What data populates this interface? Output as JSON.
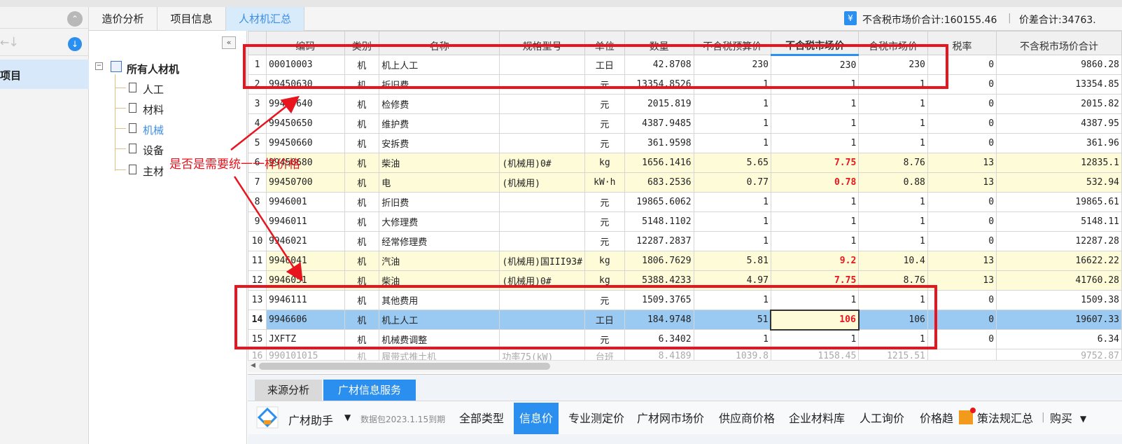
{
  "top_tabs": [
    {
      "label": "造价分析",
      "active": false
    },
    {
      "label": "项目信息",
      "active": false
    },
    {
      "label": "人材机汇总",
      "active": true
    }
  ],
  "summary": {
    "market_total": "不含税市场价合计:160155.46",
    "diff_total": "价差合计:34763."
  },
  "left_panel": {
    "project_label": "项目"
  },
  "tree": {
    "root": "所有人材机",
    "children": [
      "人工",
      "材料",
      "机械",
      "设备",
      "主材"
    ],
    "active_child": "机械"
  },
  "grid": {
    "columns": [
      "编码",
      "类别",
      "名称",
      "规格型号",
      "单位",
      "数量",
      "不含税预算价",
      "不含税市场价",
      "含税市场价",
      "税率",
      "不含税市场价合计"
    ],
    "rows": [
      {
        "n": "1",
        "code": "00010003",
        "type": "机",
        "name": "机上人工",
        "spec": "",
        "unit": "工日",
        "qty": "42.8708",
        "budget": "230",
        "market": "230",
        "tax_market": "230",
        "rate": "0",
        "total": "9860.28",
        "style": ""
      },
      {
        "n": "2",
        "code": "99450630",
        "type": "机",
        "name": "折旧费",
        "spec": "",
        "unit": "元",
        "qty": "13354.8526",
        "budget": "1",
        "market": "1",
        "tax_market": "1",
        "rate": "0",
        "total": "13354.85",
        "style": ""
      },
      {
        "n": "3",
        "code": "99450640",
        "type": "机",
        "name": "检修费",
        "spec": "",
        "unit": "元",
        "qty": "2015.819",
        "budget": "1",
        "market": "1",
        "tax_market": "1",
        "rate": "0",
        "total": "2015.82",
        "style": ""
      },
      {
        "n": "4",
        "code": "99450650",
        "type": "机",
        "name": "维护费",
        "spec": "",
        "unit": "元",
        "qty": "4387.9485",
        "budget": "1",
        "market": "1",
        "tax_market": "1",
        "rate": "0",
        "total": "4387.95",
        "style": ""
      },
      {
        "n": "5",
        "code": "99450660",
        "type": "机",
        "name": "安拆费",
        "spec": "",
        "unit": "元",
        "qty": "361.9598",
        "budget": "1",
        "market": "1",
        "tax_market": "1",
        "rate": "0",
        "total": "361.96",
        "style": ""
      },
      {
        "n": "6",
        "code": "99450680",
        "type": "机",
        "name": "柴油",
        "spec": "(机械用)0#",
        "unit": "kg",
        "qty": "1656.1416",
        "budget": "5.65",
        "market": "7.75",
        "tax_market": "8.76",
        "rate": "13",
        "total": "12835.1",
        "style": "yel"
      },
      {
        "n": "7",
        "code": "99450700",
        "type": "机",
        "name": "电",
        "spec": "(机械用)",
        "unit": "kW·h",
        "qty": "683.2536",
        "budget": "0.77",
        "market": "0.78",
        "tax_market": "0.88",
        "rate": "13",
        "total": "532.94",
        "style": "yel"
      },
      {
        "n": "8",
        "code": "9946001",
        "type": "机",
        "name": "折旧费",
        "spec": "",
        "unit": "元",
        "qty": "19865.6062",
        "budget": "1",
        "market": "1",
        "tax_market": "1",
        "rate": "0",
        "total": "19865.61",
        "style": ""
      },
      {
        "n": "9",
        "code": "9946011",
        "type": "机",
        "name": "大修理费",
        "spec": "",
        "unit": "元",
        "qty": "5148.1102",
        "budget": "1",
        "market": "1",
        "tax_market": "1",
        "rate": "0",
        "total": "5148.11",
        "style": ""
      },
      {
        "n": "10",
        "code": "9946021",
        "type": "机",
        "name": "经常修理费",
        "spec": "",
        "unit": "元",
        "qty": "12287.2837",
        "budget": "1",
        "market": "1",
        "tax_market": "1",
        "rate": "0",
        "total": "12287.28",
        "style": ""
      },
      {
        "n": "11",
        "code": "9946041",
        "type": "机",
        "name": "汽油",
        "spec": "(机械用)国III93#",
        "unit": "kg",
        "qty": "1806.7629",
        "budget": "5.81",
        "market": "9.2",
        "tax_market": "10.4",
        "rate": "13",
        "total": "16622.22",
        "style": "yel"
      },
      {
        "n": "12",
        "code": "9946051",
        "type": "机",
        "name": "柴油",
        "spec": "(机械用)0#",
        "unit": "kg",
        "qty": "5388.4233",
        "budget": "4.97",
        "market": "7.75",
        "tax_market": "8.76",
        "rate": "13",
        "total": "41760.28",
        "style": "yel"
      },
      {
        "n": "13",
        "code": "9946111",
        "type": "机",
        "name": "其他费用",
        "spec": "",
        "unit": "元",
        "qty": "1509.3765",
        "budget": "1",
        "market": "1",
        "tax_market": "1",
        "rate": "0",
        "total": "1509.38",
        "style": ""
      },
      {
        "n": "14",
        "code": "9946606",
        "type": "机",
        "name": "机上人工",
        "spec": "",
        "unit": "工日",
        "qty": "184.9748",
        "budget": "51",
        "market": "106",
        "tax_market": "106",
        "rate": "0",
        "total": "19607.33",
        "style": "sel"
      },
      {
        "n": "15",
        "code": "JXFTZ",
        "type": "机",
        "name": "机械费调整",
        "spec": "",
        "unit": "元",
        "qty": "6.3402",
        "budget": "1",
        "market": "1",
        "tax_market": "1",
        "rate": "0",
        "total": "6.34",
        "style": ""
      },
      {
        "n": "16",
        "code": "990101015",
        "type": "机",
        "name": "履带式推土机",
        "spec": "功率75(kW)",
        "unit": "台班",
        "qty": "8.4189",
        "budget": "1039.8",
        "market": "1158.45",
        "tax_market": "1215.51",
        "rate": "",
        "total": "9752.87",
        "style": "faded"
      }
    ],
    "red_market_rows": [
      "6",
      "7",
      "11",
      "12",
      "14"
    ]
  },
  "bottom_tabs": [
    "来源分析",
    "广材信息服务"
  ],
  "bottom_tools": {
    "helper": "广材助手",
    "package": "数据包2023.1.15到期",
    "items": [
      "全部类型",
      "信息价",
      "专业测定价",
      "广材网市场价",
      "供应商价格",
      "企业材料库",
      "人工询价",
      "价格趋",
      "策法规汇总",
      "购买"
    ],
    "active": "信息价"
  },
  "annotation": {
    "text": "是否是需要统一一样价格",
    "color": "#e8141e"
  },
  "colors": {
    "accent": "#2b8ff0",
    "selected_row": "#9ac9f2",
    "highlight_row": "#fefbd8",
    "red": "#e8141e"
  }
}
